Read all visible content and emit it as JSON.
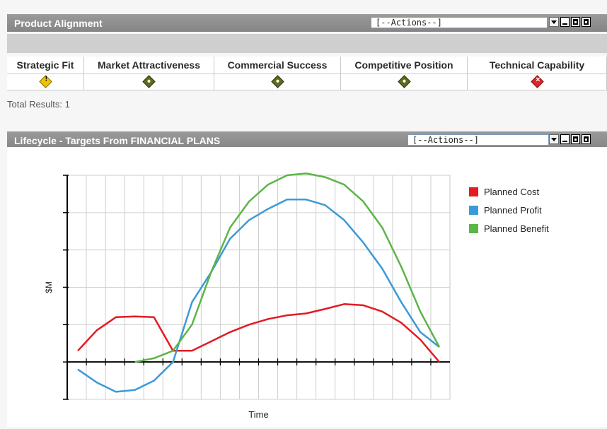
{
  "panel1": {
    "title": "Product Alignment",
    "actions": "[--Actions--]",
    "columns": [
      "Strategic Fit",
      "Market Attractiveness",
      "Commercial Success",
      "Competitive Position",
      "Technical Capability"
    ],
    "statuses": [
      "warning",
      "ok",
      "ok",
      "ok",
      "error"
    ],
    "total": "Total Results: 1"
  },
  "panel2": {
    "title": "Lifecycle - Targets From FINANCIAL PLANS",
    "actions": "[--Actions--]"
  },
  "chart_data": {
    "type": "line",
    "title": "",
    "xlabel": "Time",
    "ylabel": "$M",
    "grid": true,
    "legend": "right",
    "x": [
      1,
      2,
      3,
      4,
      5,
      6,
      7,
      8,
      9,
      10,
      11,
      12,
      13,
      14,
      15,
      16,
      17,
      18,
      19,
      20
    ],
    "series": [
      {
        "name": "Planned Cost",
        "color": "#e31b23",
        "values": [
          0.3,
          0.85,
          1.2,
          1.22,
          1.2,
          0.3,
          0.3,
          0.55,
          0.8,
          1.0,
          1.15,
          1.25,
          1.3,
          1.42,
          1.55,
          1.52,
          1.35,
          1.05,
          0.6,
          0.0
        ]
      },
      {
        "name": "Planned Profit",
        "color": "#3b9ad9",
        "values": [
          -0.2,
          -0.55,
          -0.8,
          -0.75,
          -0.5,
          0.0,
          1.6,
          2.4,
          3.3,
          3.8,
          4.1,
          4.35,
          4.35,
          4.2,
          3.8,
          3.2,
          2.5,
          1.6,
          0.8,
          0.4
        ]
      },
      {
        "name": "Planned Benefit",
        "color": "#5cb547",
        "values": [
          null,
          null,
          null,
          0.0,
          0.1,
          0.3,
          1.0,
          2.4,
          3.6,
          4.3,
          4.75,
          5.0,
          5.05,
          4.95,
          4.75,
          4.3,
          3.6,
          2.55,
          1.35,
          0.4
        ]
      }
    ],
    "ylim": [
      -1,
      5
    ],
    "y_ticks": 6,
    "x_grid_lines": 19
  }
}
